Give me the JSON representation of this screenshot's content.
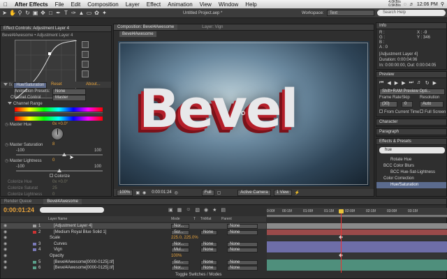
{
  "menubar": {
    "app": "After Effects",
    "items": [
      "File",
      "Edit",
      "Composition",
      "Layer",
      "Effect",
      "Animation",
      "View",
      "Window",
      "Help"
    ],
    "net": "4.0KB/s\n0.5KB/s",
    "clock": "12:06 PM"
  },
  "toolbar": {
    "doc_title": "Untitled Project.aep *",
    "workspace_label": "Workspace:",
    "workspace_value": "Text",
    "search_placeholder": "Search Help"
  },
  "effect_controls": {
    "tab": "Effect Controls: Adjustment Layer 4",
    "path": "Bevel4Awesome • Adjustment Layer 4",
    "effect_name": "Hue/Saturation",
    "reset": "Reset",
    "about": "About...",
    "presets_label": "Animation Presets:",
    "presets_value": "None",
    "channel_control_label": "Channel Control",
    "channel_control_value": "Master",
    "channel_range": "Channel Range",
    "master_hue_label": "Master Hue",
    "master_hue_value": "0x +0.0°",
    "master_sat_label": "Master Saturation",
    "master_sat_value": "8",
    "master_light_label": "Master Lightness",
    "master_light_value": "0",
    "range_min": "-100",
    "range_max": "100",
    "colorize": "Colorize",
    "colorize_hue": "Colorize Hue",
    "colorize_hue_value": "0x +0.0°",
    "colorize_sat": "Colorize Saturat",
    "colorize_sat_value": "25",
    "colorize_light": "Colorize Lightness",
    "colorize_light_value": "0"
  },
  "composition": {
    "tab": "Composition: Bevel4Awesome",
    "layer_tab": "Layer: Vign",
    "crumb": "Bevel4Awesome",
    "artwork_text": "Bevel",
    "zoom": "100%",
    "timecode": "0:00:01:24",
    "resolution": "Full",
    "camera": "Active Camera",
    "views": "1 View"
  },
  "info": {
    "tab": "Info",
    "r": "R :",
    "g": "G :",
    "b": "B :",
    "a": "A : 0",
    "x": "X : -9",
    "y": "Y : 346",
    "layer": "[Adjustment Layer 4]",
    "duration": "Duration: 0:00:04:06",
    "in": "In: 0:00:00:00, Out: 0:00:04:05"
  },
  "preview": {
    "tab": "Preview",
    "mode": "Shift+RAM Preview Opti...",
    "frame_rate_label": "Frame Rate",
    "skip_label": "Skip",
    "resolution_label": "Resolution",
    "frame_rate": "(30)",
    "skip": "0",
    "resolution": "Auto",
    "from_current": "From Current Time",
    "full_screen": "Full Screen"
  },
  "character": {
    "tab": "Character"
  },
  "paragraph": {
    "tab": "Paragraph"
  },
  "effects_presets": {
    "tab": "Effects & Presets",
    "search_value": "hue",
    "items": [
      {
        "label": "Rotate Hue",
        "indent": 2
      },
      {
        "label": "BCC Color Blurs",
        "indent": 1
      },
      {
        "label": "BCC Hue-Sat-Lightness",
        "indent": 2
      },
      {
        "label": "Color Correction",
        "indent": 1
      },
      {
        "label": "Hue/Saturation",
        "indent": 2
      }
    ]
  },
  "timeline": {
    "tabs": [
      "Render Queue",
      "Bevel4Awesome"
    ],
    "timecode": "0:00:01:24",
    "columns": [
      "Layer Name",
      "Mode",
      "T",
      "TrkMat",
      "Parent"
    ],
    "ruler": [
      "0:00f",
      "00:15f",
      "01:00f",
      "01:15f",
      "02:00f",
      "02:15f",
      "03:00f",
      "03:15f"
    ],
    "toggle": "Toggle Switches / Modes",
    "layers": [
      {
        "num": "1",
        "name": "[Adjustment Layer 4]",
        "mode": "Nor...",
        "trk": "",
        "parent": "None",
        "color": "#9e9e9e",
        "bar": "#8a8a8a",
        "selected": true
      },
      {
        "num": "2",
        "name": "[Medium Royal Blue Solid 1]",
        "mode": "Scr...",
        "trk": "None",
        "parent": "None",
        "color": "#c33",
        "bar": "#9a4a4a",
        "selected": false
      },
      {
        "num": "",
        "name": "Scale",
        "mode": "",
        "trk": "",
        "parent": "",
        "value": "225.0, 225.0%",
        "color": "",
        "bar": "",
        "selected": false
      },
      {
        "num": "3",
        "name": "Curves",
        "mode": "Nor...",
        "trk": "None",
        "parent": "None",
        "color": "#7a7ab8",
        "bar": "#6e6ea8",
        "selected": false
      },
      {
        "num": "4",
        "name": "Vign",
        "mode": "Mul...",
        "trk": "None",
        "parent": "None",
        "color": "#7a7ab8",
        "bar": "#6e6ea8",
        "selected": false
      },
      {
        "num": "",
        "name": "Opacity",
        "mode": "",
        "trk": "",
        "parent": "",
        "value": "100%",
        "color": "",
        "bar": "",
        "selected": false
      },
      {
        "num": "5",
        "name": "[Bevel4Awesome[0000-0125].tif]",
        "mode": "Scr...",
        "trk": "None",
        "parent": "None",
        "color": "#5aa08a",
        "bar": "#4f8f7c",
        "selected": false
      },
      {
        "num": "6",
        "name": "[Bevel4Awesome[0000-0125].tif]",
        "mode": "Nor...",
        "trk": "None",
        "parent": "None",
        "color": "#5aa08a",
        "bar": "#4f8f7c",
        "selected": false
      }
    ]
  }
}
